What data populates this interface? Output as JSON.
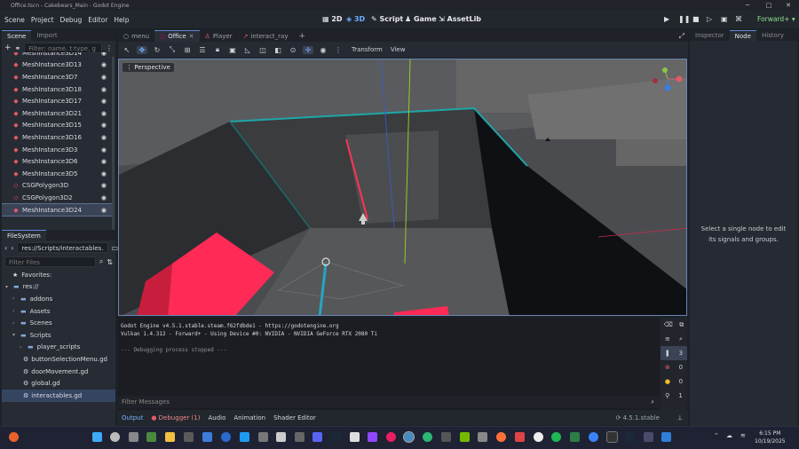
{
  "window": {
    "title": "Office.tscn - Cakebears_Main - Godot Engine"
  },
  "menu": [
    "Scene",
    "Project",
    "Debug",
    "Editor",
    "Help"
  ],
  "workspaces": [
    "2D",
    "3D",
    "Script",
    "Game",
    "AssetLib"
  ],
  "active_workspace": "3D",
  "renderer": "Forward+",
  "scene_dock": {
    "tabs": [
      "Scene",
      "Import"
    ],
    "filter_placeholder": "Filter: name, t:type, g",
    "nodes": [
      "MeshInstance3D14",
      "MeshInstance3D13",
      "MeshInstance3D7",
      "MeshInstance3D18",
      "MeshInstance3D17",
      "MeshInstance3D21",
      "MeshInstance3D15",
      "MeshInstance3D16",
      "MeshInstance3D3",
      "MeshInstance3D6",
      "MeshInstance3D5",
      "CSGPolygon3D",
      "CSGPolygon3D2",
      "MeshInstance3D24"
    ],
    "selected": "MeshInstance3D24"
  },
  "filesystem": {
    "title": "FileSystem",
    "path": "res://Scripts/interactables.",
    "filter_placeholder": "Filter Files",
    "favorites": "Favorites:",
    "root": "res://",
    "folders": [
      "addons",
      "Assets",
      "Scenes",
      "Scripts"
    ],
    "subfolder": "player_scripts",
    "files": [
      "buttonSelectionMenu.gd",
      "doorMovement.gd",
      "global.gd",
      "interactables.gd"
    ],
    "selected": "interactables.gd"
  },
  "scene_tabs": [
    "menu",
    "Office",
    "Player",
    "interact_ray"
  ],
  "active_scene_tab": "Office",
  "viewport_toolbar": {
    "transform": "Transform",
    "view": "View"
  },
  "viewport": {
    "label": "Perspective"
  },
  "output": {
    "lines": [
      "Godot Engine v4.5.1.stable.steam.f62fdbde1 - https://godotengine.org",
      "Vulkan 1.4.312 - Forward+ - Using Device #0: NVIDIA - NVIDIA GeForce RTX 2080 Ti",
      "",
      "--- Debugging process stopped ---"
    ],
    "filter_placeholder": "Filter Messages",
    "counts": {
      "messages": "3",
      "errors": "0",
      "warnings": "0",
      "info": "1"
    }
  },
  "bottom_tabs": [
    "Output",
    "Debugger (1)",
    "Audio",
    "Animation",
    "Shader Editor"
  ],
  "version": "4.5.1.stable",
  "right_dock": {
    "tabs": [
      "Inspector",
      "Node",
      "History"
    ],
    "active": "Node",
    "message": "Select a single node to edit its signals and groups."
  },
  "taskbar": {
    "time": "6:15 PM",
    "date": "10/19/2025"
  },
  "colors": {
    "accent": "#5a8ad6",
    "error_red": "#e05b6b",
    "mesh_pink": "#ff2a55"
  }
}
